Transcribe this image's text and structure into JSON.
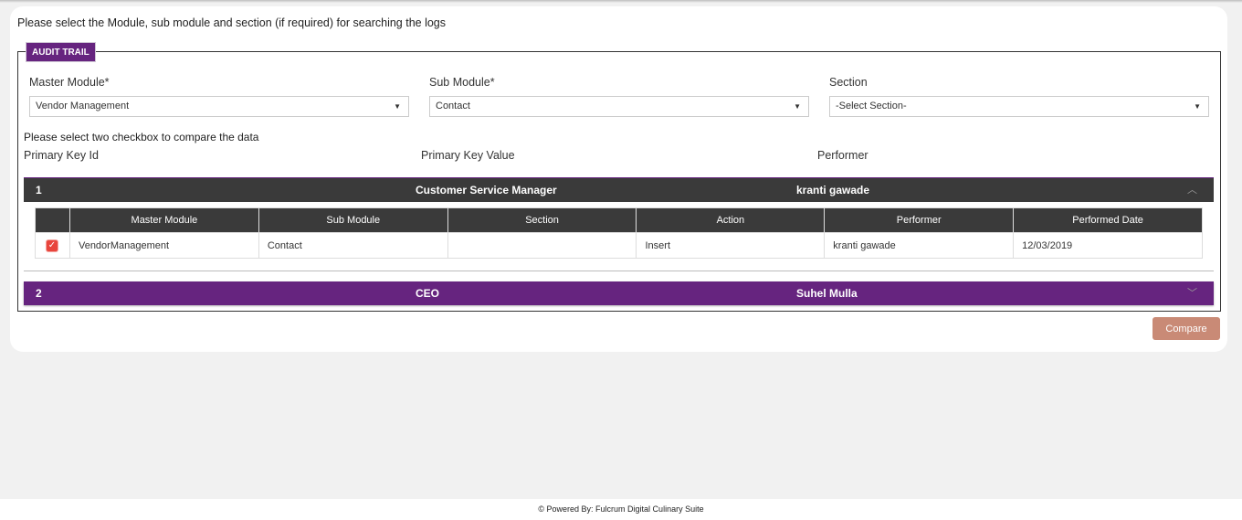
{
  "intro_text": "Please select the Module, sub module and section (if required) for searching the logs",
  "fieldset": {
    "legend": "AUDIT TRAIL",
    "filters": [
      {
        "label": "Master Module*",
        "value": "Vendor Management"
      },
      {
        "label": "Sub Module*",
        "value": "Contact"
      },
      {
        "label": "Section",
        "value": "-Select Section-"
      }
    ],
    "hint": "Please select two checkbox to compare the data",
    "column_labels": [
      "Primary Key Id",
      "Primary Key Value",
      "Performer"
    ]
  },
  "records": [
    {
      "id": "1",
      "key_value": "Customer Service Manager",
      "performer": "kranti gawade",
      "expanded": true,
      "table": {
        "headers": [
          "",
          "Master Module",
          "Sub Module",
          "Section",
          "Action",
          "Performer",
          "Performed Date"
        ],
        "rows": [
          {
            "checked": true,
            "master_module": "VendorManagement",
            "sub_module": "Contact",
            "section": "",
            "action": "Insert",
            "performer": "kranti gawade",
            "performed_date": "12/03/2019"
          }
        ]
      }
    },
    {
      "id": "2",
      "key_value": "CEO",
      "performer": "Suhel Mulla",
      "expanded": false
    }
  ],
  "compare_label": "Compare",
  "footer": "© Powered By: Fulcrum Digital Culinary Suite",
  "colors": {
    "accent_purple": "#66247f",
    "header_dark": "#3a3a3a",
    "compare_button": "#c98a76",
    "checkbox": "#e8453c"
  }
}
